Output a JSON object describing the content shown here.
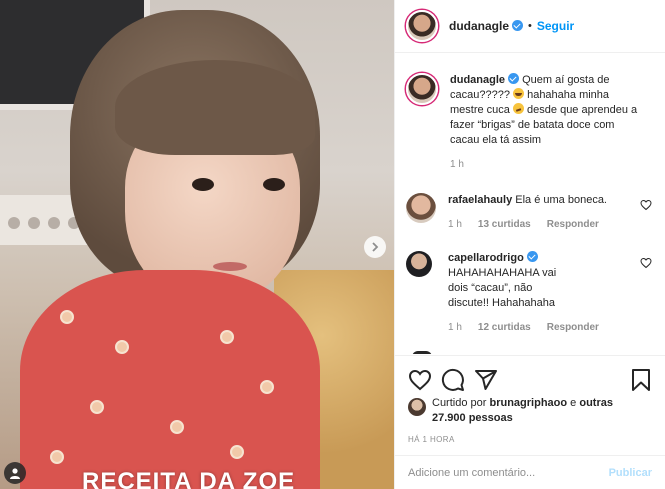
{
  "post": {
    "media": {
      "overlay_text": "RECEITA DA ZOE",
      "next_icon": "chevron-right-icon",
      "tag_icon": "user-tag-icon"
    },
    "header": {
      "username": "dudanagle",
      "separator": "•",
      "follow_label": "Seguir",
      "verified_icon": "verified-badge-icon"
    },
    "caption": {
      "username": "dudanagle",
      "text_1": "Quem aí gosta de cacau?????",
      "text_2": "hahahaha minha mestre cuca",
      "text_3": "desde que aprendeu a fazer “brigas” de batata doce com cacau ela tá assim",
      "time": "1 h"
    },
    "comments": [
      {
        "username": "rafaelahauly",
        "text": "Ela é uma boneca.",
        "time": "1 h",
        "likes": "13 curtidas",
        "reply_label": "Responder"
      },
      {
        "username": "capellarodrigo",
        "text": "HAHAHAHAHAHA vai dois “cacau”, não discute!! Hahahahaha",
        "time": "1 h",
        "likes": "12 curtidas",
        "reply_label": "Responder"
      }
    ],
    "actions": {
      "like_icon": "heart-icon",
      "comment_icon": "comment-icon",
      "share_icon": "share-icon",
      "save_icon": "bookmark-icon"
    },
    "likes": {
      "prefix": "Curtido por",
      "user": "brunagriphaoo",
      "conj": "e",
      "others": "outras 27.900 pessoas"
    },
    "timestamp": "HÁ 1 HORA",
    "add_comment": {
      "placeholder": "Adicione um comentário...",
      "publish_label": "Publicar"
    },
    "colors": {
      "accent": "#0095f6",
      "publish_disabled": "#b2dffc",
      "muted": "#8e8e8e",
      "verified": "#3897f0"
    }
  }
}
